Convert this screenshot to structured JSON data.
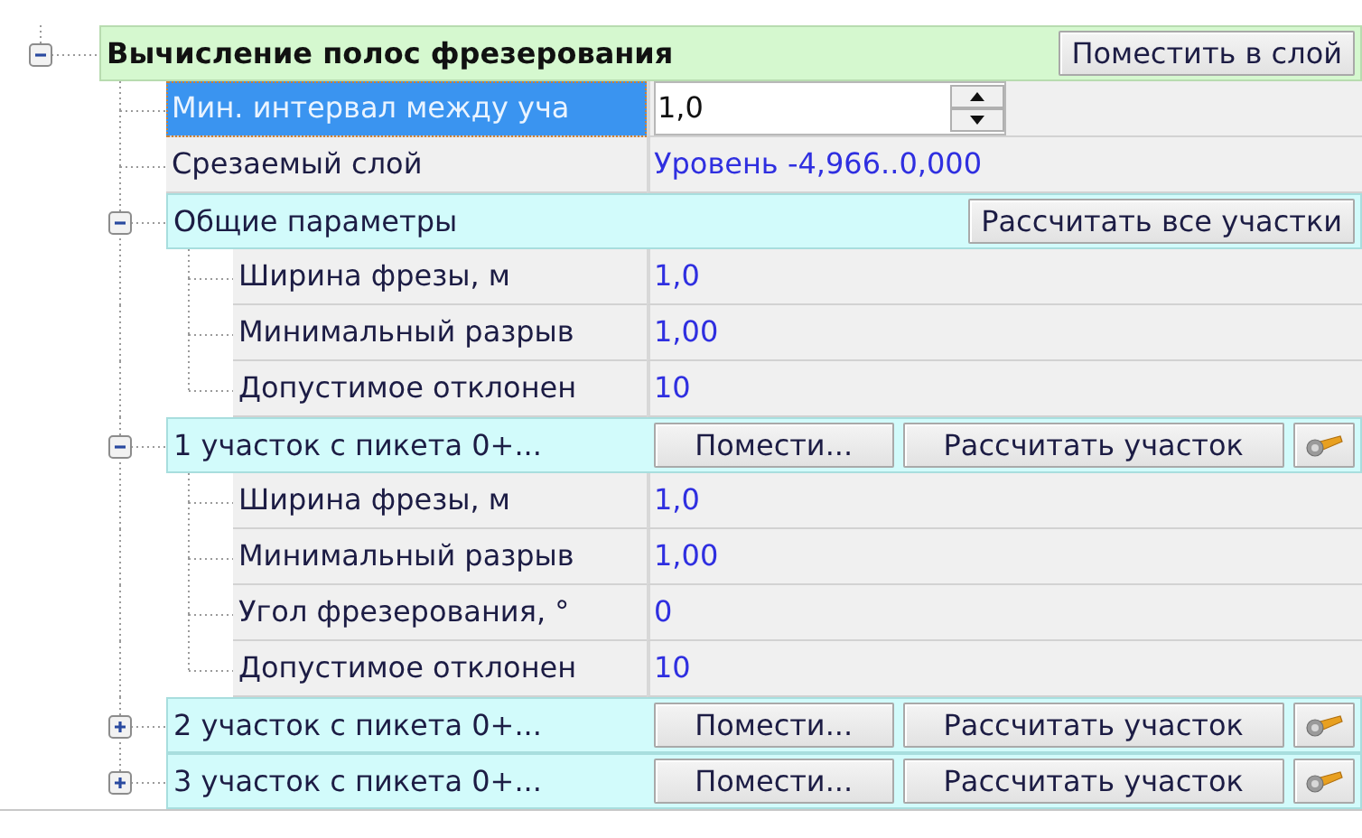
{
  "tree": {
    "kind": "root",
    "label": "Вычисление полос фрезерования",
    "expanded": true,
    "selected": false,
    "buttons": [
      {
        "kind": "text",
        "label": "Поместить в слой"
      }
    ],
    "children": [
      {
        "kind": "spin",
        "label": "Мин. интервал между уча",
        "value": "1,0",
        "selected": true
      },
      {
        "kind": "property",
        "label": "Срезаемый слой",
        "value": "Уровень -4,966..0,000",
        "selected": false
      },
      {
        "kind": "group",
        "label": "Общие параметры",
        "expanded": true,
        "selected": false,
        "buttons": [
          {
            "kind": "text",
            "label": "Рассчитать все участки"
          }
        ],
        "children": [
          {
            "kind": "property",
            "label": "Ширина фрезы, м",
            "value": "1,0",
            "selected": false
          },
          {
            "kind": "property",
            "label": "Минимальный разрыв",
            "value": "1,00",
            "selected": false
          },
          {
            "kind": "property",
            "label": "Допустимое отклонен",
            "value": "10",
            "selected": false
          }
        ]
      },
      {
        "kind": "group",
        "label": "1 участок с пикета 0+...",
        "expanded": true,
        "selected": false,
        "buttons": [
          {
            "kind": "text",
            "label": "Помести..."
          },
          {
            "kind": "text",
            "label": "Рассчитать участок"
          },
          {
            "kind": "icon"
          }
        ],
        "children": [
          {
            "kind": "property",
            "label": "Ширина фрезы, м",
            "value": "1,0",
            "selected": false
          },
          {
            "kind": "property",
            "label": "Минимальный разрыв",
            "value": "1,00",
            "selected": false
          },
          {
            "kind": "property",
            "label": "Угол фрезерования, °",
            "value": "0",
            "selected": false
          },
          {
            "kind": "property",
            "label": "Допустимое отклонен",
            "value": "10",
            "selected": false
          }
        ]
      },
      {
        "kind": "group",
        "label": "2 участок с пикета 0+...",
        "expanded": false,
        "selected": false,
        "buttons": [
          {
            "kind": "text",
            "label": "Помести..."
          },
          {
            "kind": "text",
            "label": "Рассчитать участок"
          },
          {
            "kind": "icon"
          }
        ]
      },
      {
        "kind": "group",
        "label": "3 участок с пикета 0+...",
        "expanded": false,
        "selected": false,
        "buttons": [
          {
            "kind": "text",
            "label": "Помести..."
          },
          {
            "kind": "text",
            "label": "Рассчитать участок"
          },
          {
            "kind": "icon"
          }
        ]
      }
    ]
  }
}
